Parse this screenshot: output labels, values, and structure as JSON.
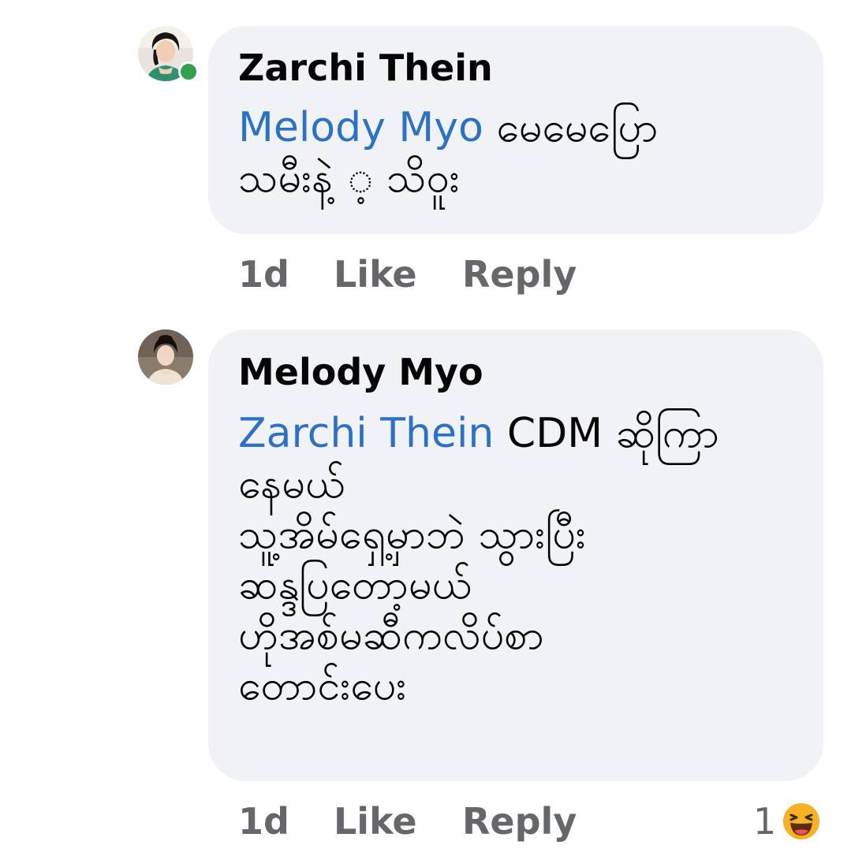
{
  "comments": [
    {
      "author": "Zarchi Thein",
      "lines": [
        {
          "mention": "Melody Myo",
          "text": " မေမေပြော"
        },
        {
          "mention": "",
          "text": "သမီးနဲ့ ့ သိဝူး"
        }
      ],
      "time": "1d",
      "like_label": "Like",
      "reply_label": "Reply",
      "online": true
    },
    {
      "author": "Melody Myo",
      "lines": [
        {
          "mention": "Zarchi Thein",
          "text": " CDM ဆိုကြာ"
        },
        {
          "mention": "",
          "text": "နေမယ်"
        },
        {
          "mention": "",
          "text": "သူ့အိမ်ရှေ့မှာဘဲ သွားပြီး"
        },
        {
          "mention": "",
          "text": "ဆန္ဒပြတော့မယ်"
        },
        {
          "mention": "",
          "text": "ဟိုအစ်မဆီကလိပ်စာ"
        },
        {
          "mention": "",
          "text": "တောင်းပေး"
        }
      ],
      "time": "1d",
      "like_label": "Like",
      "reply_label": "Reply",
      "reaction_count": "1",
      "reaction_icon": "haha-emoji-icon"
    }
  ],
  "colors": {
    "bubble": "#f0f2f5",
    "mention": "#2d71c6",
    "meta": "#65676b",
    "online": "#31a24c",
    "reaction": "#f7b125"
  }
}
